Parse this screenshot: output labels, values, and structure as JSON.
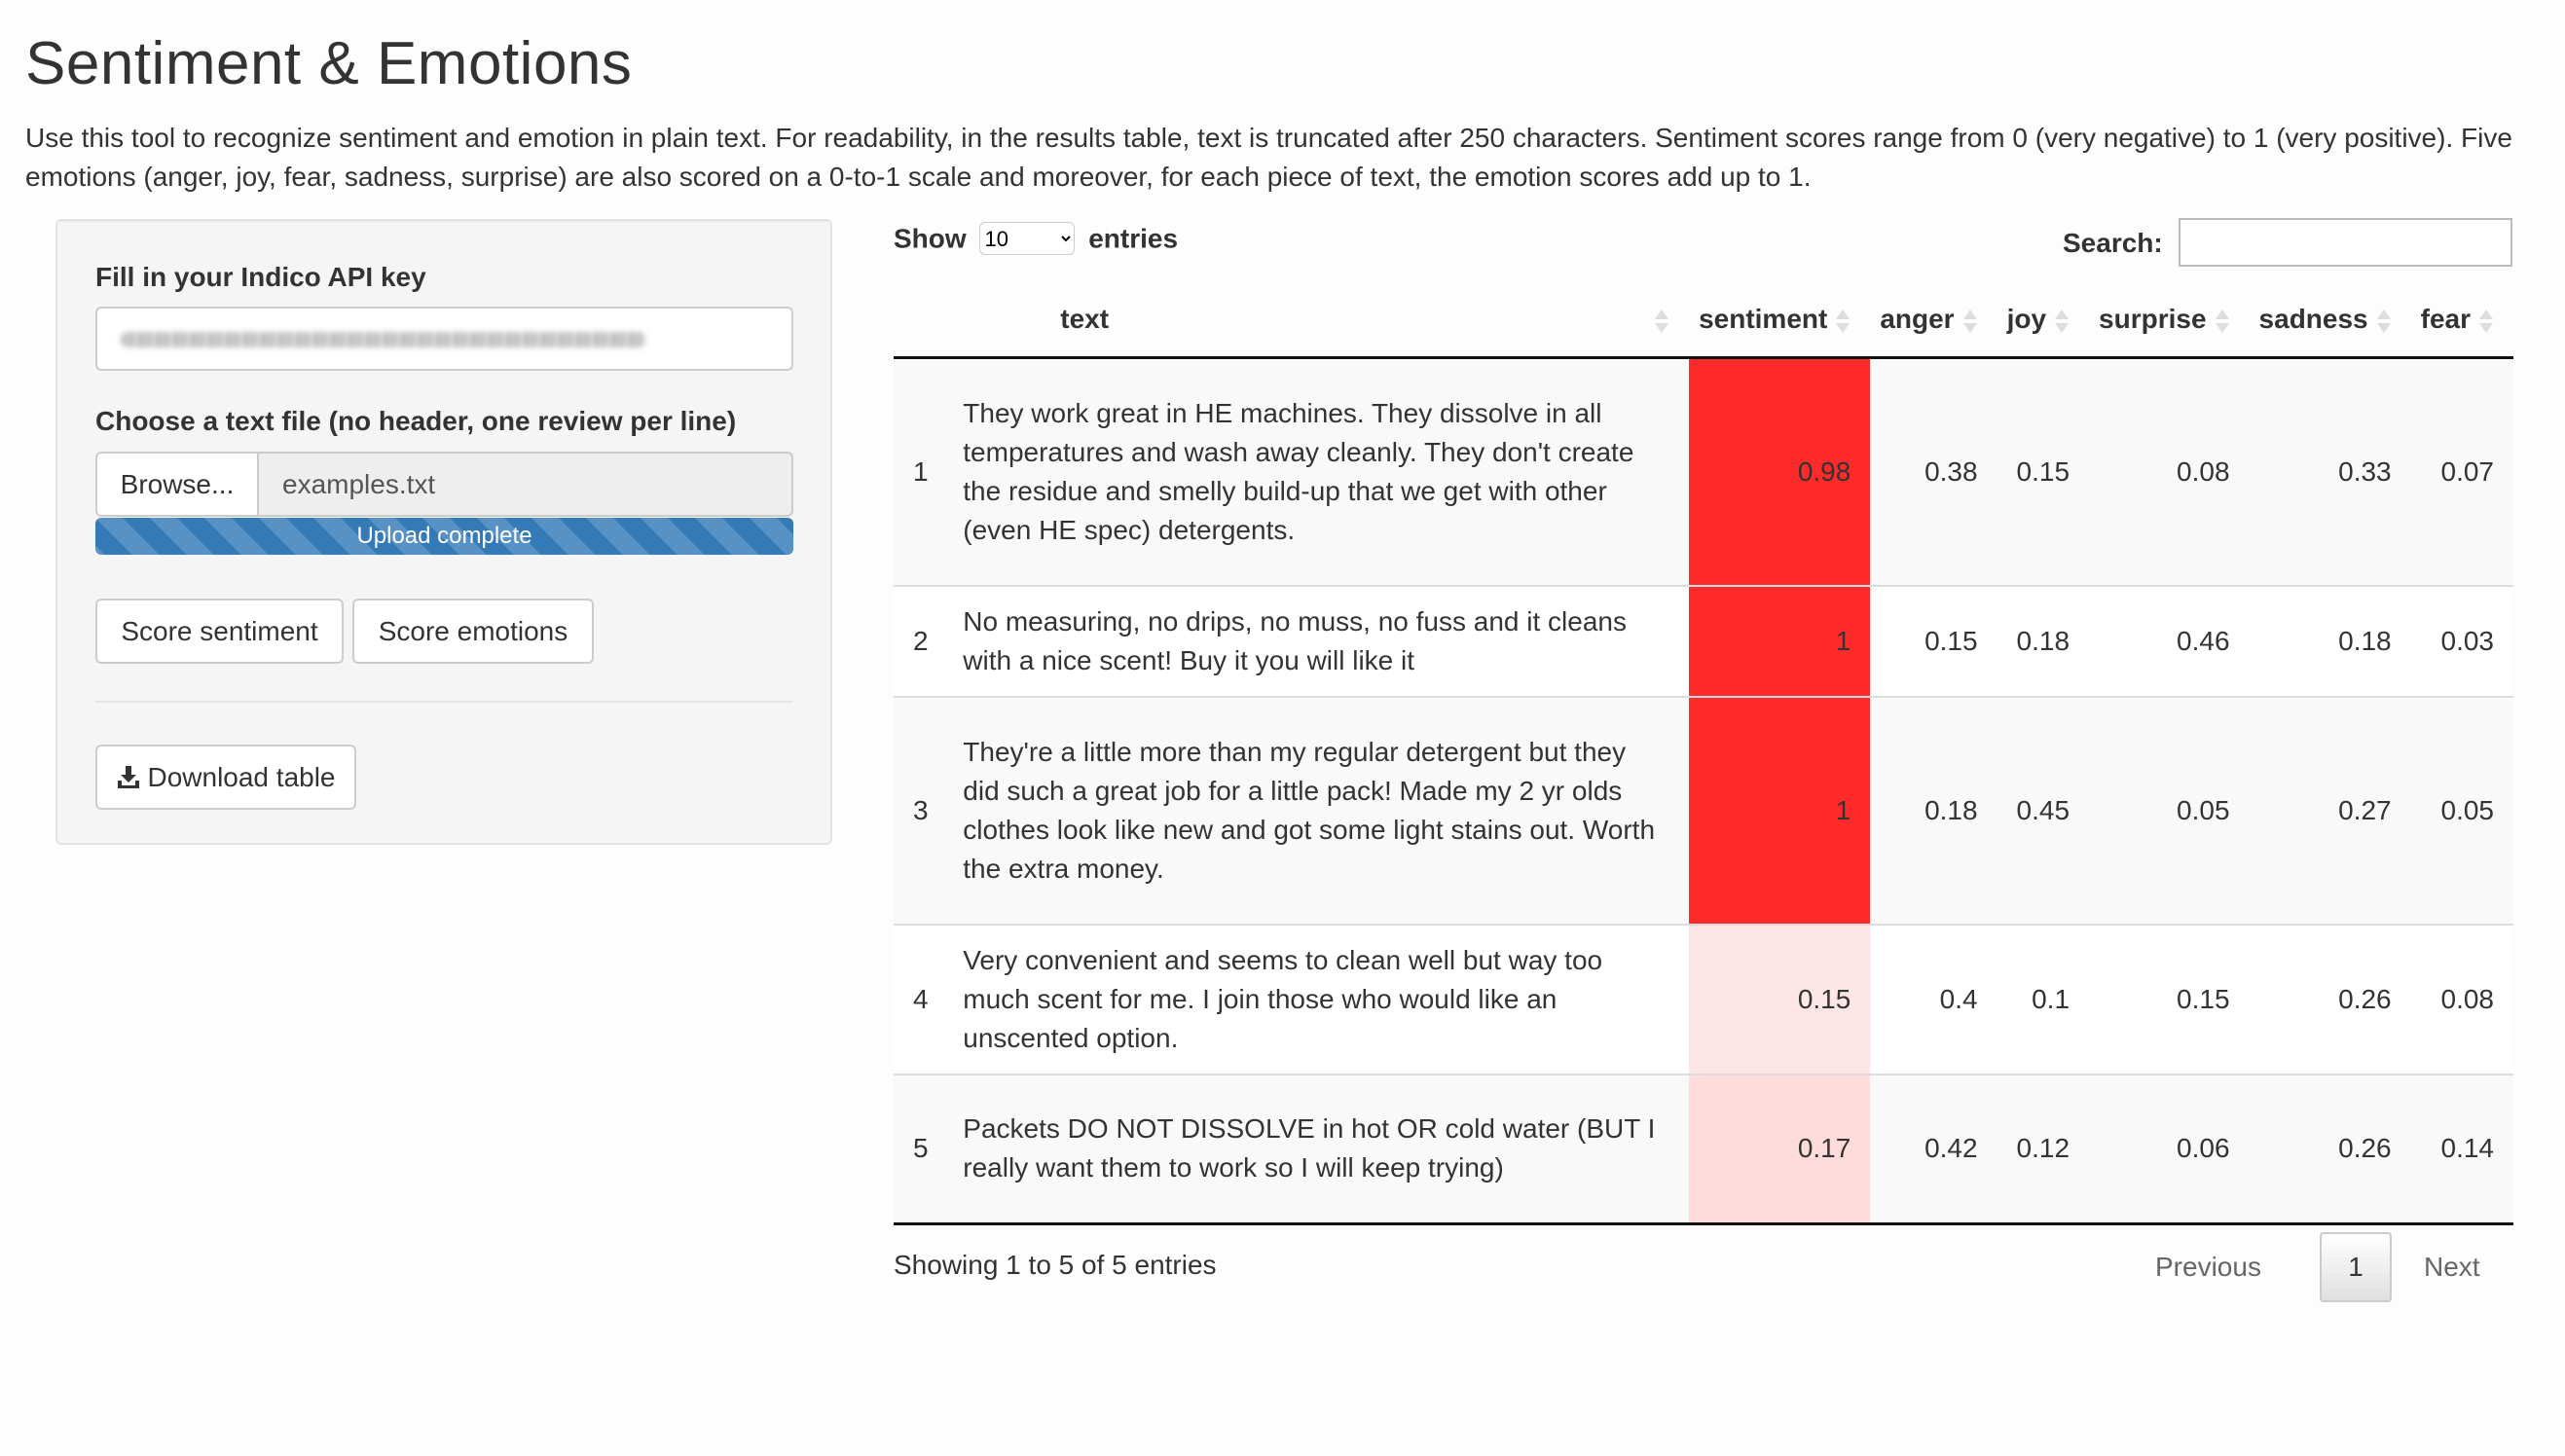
{
  "title": "Sentiment & Emotions",
  "description": "Use this tool to recognize sentiment and emotion in plain text. For readability, in the results table, text is truncated after 250 characters. Sentiment scores range from 0 (very negative) to 1 (very positive). Five emotions (anger, joy, fear, sadness, surprise) are also scored on a 0-to-1 scale and moreover, for each piece of text, the emotion scores add up to 1.",
  "sidebar": {
    "api_label": "Fill in your Indico API key",
    "file_label": "Choose a text file (no header, one review per line)",
    "browse_label": "Browse...",
    "file_name": "examples.txt",
    "upload_status": "Upload complete",
    "upload_progress_pct": 100,
    "score_sentiment_label": "Score sentiment",
    "score_emotions_label": "Score emotions",
    "download_label": "Download table",
    "download_icon": "download-icon"
  },
  "table_controls": {
    "show_label": "Show",
    "entries_label": "entries",
    "page_length": "10",
    "search_label": "Search:"
  },
  "table": {
    "columns": [
      "",
      "text",
      "sentiment",
      "anger",
      "joy",
      "surprise",
      "sadness",
      "fear"
    ],
    "rows": [
      {
        "idx": "1",
        "text": "They work great in HE machines. They dissolve in all temperatures and wash away cleanly. They don't create the residue and smelly build-up that we get with other (even HE spec) detergents.",
        "sentiment": "0.98",
        "anger": "0.38",
        "joy": "0.15",
        "surprise": "0.08",
        "sadness": "0.33",
        "fear": "0.07",
        "sentiment_color": "#ff2a2a"
      },
      {
        "idx": "2",
        "text": "No measuring, no drips, no muss, no fuss and it cleans with a nice scent! Buy it you will like it",
        "sentiment": "1",
        "anger": "0.15",
        "joy": "0.18",
        "surprise": "0.46",
        "sadness": "0.18",
        "fear": "0.03",
        "sentiment_color": "#ff2a2a"
      },
      {
        "idx": "3",
        "text": "They're a little more than my regular detergent but they did such a great job for a little pack! Made my 2 yr olds clothes look like new and got some light stains out. Worth the extra money.",
        "sentiment": "1",
        "anger": "0.18",
        "joy": "0.45",
        "surprise": "0.05",
        "sadness": "0.27",
        "fear": "0.05",
        "sentiment_color": "#ff2a2a"
      },
      {
        "idx": "4",
        "text": "Very convenient and seems to clean well but way too much scent for me. I join those who would like an unscented option.",
        "sentiment": "0.15",
        "anger": "0.4",
        "joy": "0.1",
        "surprise": "0.15",
        "sadness": "0.26",
        "fear": "0.08",
        "sentiment_color": "#ffe6e6"
      },
      {
        "idx": "5",
        "text": "Packets DO NOT DISSOLVE in hot OR cold water (BUT I really want them to work so I will keep trying)",
        "sentiment": "0.17",
        "anger": "0.42",
        "joy": "0.12",
        "surprise": "0.06",
        "sadness": "0.26",
        "fear": "0.14",
        "sentiment_color": "#ffdcdc"
      }
    ]
  },
  "footer": {
    "info": "Showing 1 to 5 of 5 entries",
    "previous": "Previous",
    "current_page": "1",
    "next": "Next"
  }
}
